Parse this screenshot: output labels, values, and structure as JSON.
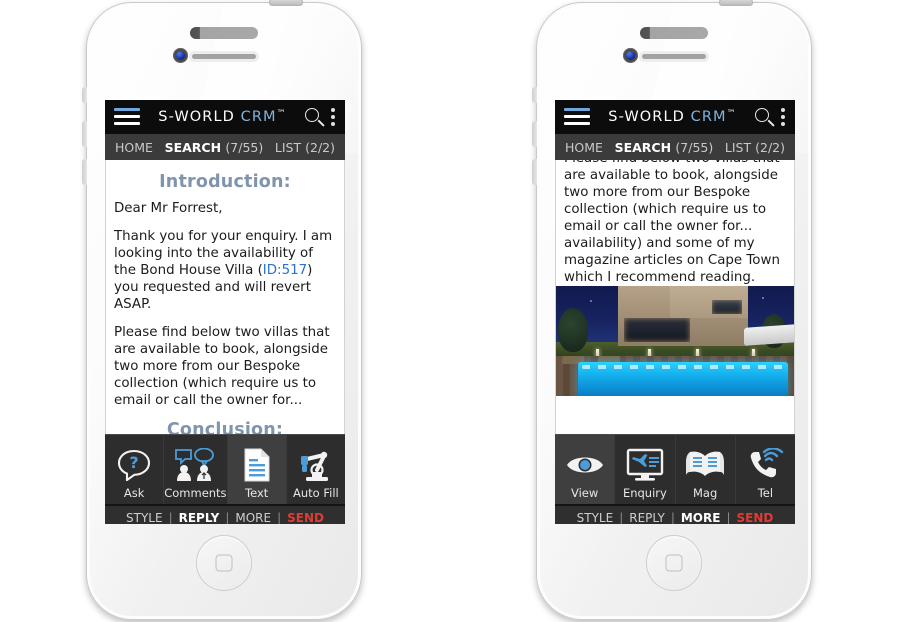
{
  "app": {
    "brand_name": "S-WORLD",
    "brand_crm": " CRM",
    "brand_tm": "™",
    "menu_icon": "hamburger-menu-icon",
    "search_icon": "search-icon",
    "overflow_icon": "kebab-menu-icon"
  },
  "nav": {
    "home": "HOME",
    "search_label": "SEARCH",
    "search_count": "(7/55)",
    "list_label": "LIST",
    "list_count": "(2/2)"
  },
  "left_phone": {
    "heading_intro": "Introduction:",
    "salutation": "Dear Mr Forrest,",
    "para_1_a": "Thank you for your enquiry. I am looking into the availability of the Bond House Villa (",
    "para_1_link": "ID:517",
    "para_1_b": ") you requested and will revert ASAP.",
    "para_2": "Please find below two villas that are available to book, alongside two more from our Bespoke collection (which require us to email or call the owner for...",
    "heading_conclusion": "Conclusion:",
    "toolbar": [
      {
        "label": "Ask",
        "icon": "question-speech-bubble-icon",
        "selected": false
      },
      {
        "label": "Comments",
        "icon": "two-people-comments-icon",
        "selected": false
      },
      {
        "label": "Text",
        "icon": "document-text-icon",
        "selected": true
      },
      {
        "label": "Auto Fill",
        "icon": "robot-arm-icon",
        "selected": false
      }
    ],
    "actions": {
      "style": "STYLE",
      "reply": "REPLY",
      "more": "MORE",
      "send": "SEND",
      "separator": "|",
      "bold_item": "REPLY"
    }
  },
  "right_phone": {
    "para_scrolled": "Please find below two villas that are available to book, alongside two more from our Bespoke collection (which require us to email or call the owner for... availability) and some of my magazine articles on Cape Town which I recommend reading.",
    "photo_alt": "modern-villa-with-illuminated-pool-at-dusk",
    "toolbar": [
      {
        "label": "View",
        "icon": "eye-view-icon",
        "selected": true
      },
      {
        "label": "Enquiry",
        "icon": "monitor-airplane-enquiry-icon",
        "selected": false
      },
      {
        "label": "Mag",
        "icon": "open-magazine-icon",
        "selected": false
      },
      {
        "label": "Tel",
        "icon": "telephone-signal-icon",
        "selected": false
      }
    ],
    "actions": {
      "style": "STYLE",
      "reply": "REPLY",
      "more": "MORE",
      "send": "SEND",
      "separator": "|",
      "bold_item": "MORE"
    }
  },
  "colors": {
    "accent_blue": "#6fa8dc",
    "brand_blue": "#7fb3dd",
    "link_blue": "#2b6fd4",
    "heading_slate": "#7f94ad",
    "send_red": "#e03b34",
    "topbar_black": "#0c0c0c",
    "navbar_gray": "#3b3b3b",
    "toolbar_gray": "#2d2d2d",
    "selected_gray": "#3f3f3f"
  }
}
